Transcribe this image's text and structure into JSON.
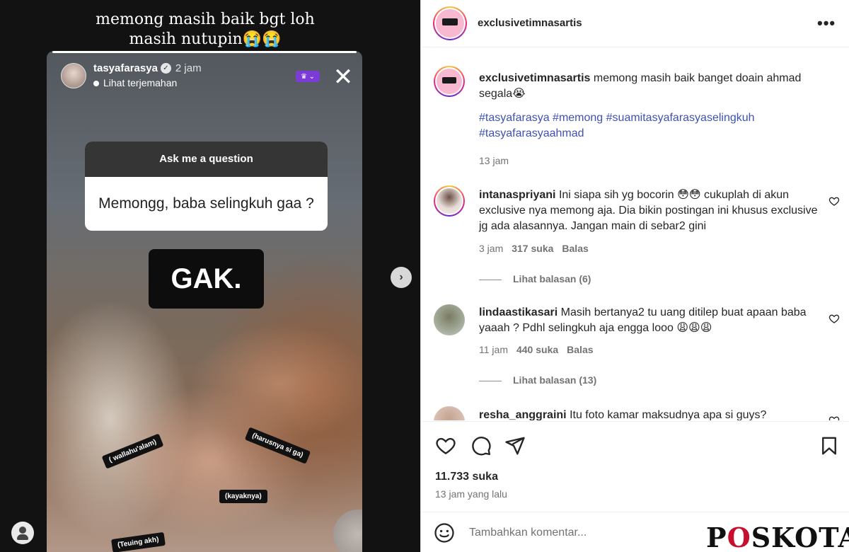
{
  "media": {
    "caption_line1": "memong masih baik bgt loh",
    "caption_line2": "masih nutupin😭😭",
    "story": {
      "username": "tasyafarasya",
      "time": "2 jam",
      "translate": "Lihat terjemahan",
      "question_title": "Ask me a question",
      "question": "Memongg, baba selingkuh gaa ?",
      "answer": "GAK.",
      "stickers": [
        "( wallahu'alam)",
        "(harusnya si ga)",
        "(kayaknya)",
        "(Teuing akh)"
      ]
    }
  },
  "post": {
    "username": "exclusivetimnasartis",
    "caption": "memong masih baik banget doain ahmad segala😭",
    "hashtags": "#tasyafarasya #memong #suamitasyafarasyaselingkuh #tasyafarasyaahmad",
    "caption_time": "13 jam",
    "likes": "11.733 suka",
    "posted": "13 jam yang lalu",
    "comment_placeholder": "Tambahkan komentar..."
  },
  "comments": [
    {
      "user": "intanaspriyani",
      "text": "Ini siapa sih yg bocorin 😳😳 cukuplah di akun exclusive nya memong aja. Dia bikin postingan ini khusus exclusive jg ada alasannya. Jangan main di sebar2 gini",
      "time": "3 jam",
      "likes": "317 suka",
      "reply": "Balas",
      "view_replies": "Lihat balasan (6)"
    },
    {
      "user": "lindaastikasari",
      "text": "Masih bertanya2 tu uang ditilep buat apaan baba yaaah ? Pdhl selingkuh aja engga looo 😩😩😩",
      "time": "11 jam",
      "likes": "440 suka",
      "reply": "Balas",
      "view_replies": "Lihat balasan (13)"
    },
    {
      "user": "resha_anggraini",
      "text": "Itu foto kamar maksudnya apa si guys?"
    }
  ],
  "watermark": {
    "left": "P",
    "o": "O",
    "right": "SKOTA"
  },
  "colors": {
    "hashtag": "#3f51b5",
    "story_ring": "#ee2a7b",
    "crown_badge": "#7b3bd6"
  }
}
